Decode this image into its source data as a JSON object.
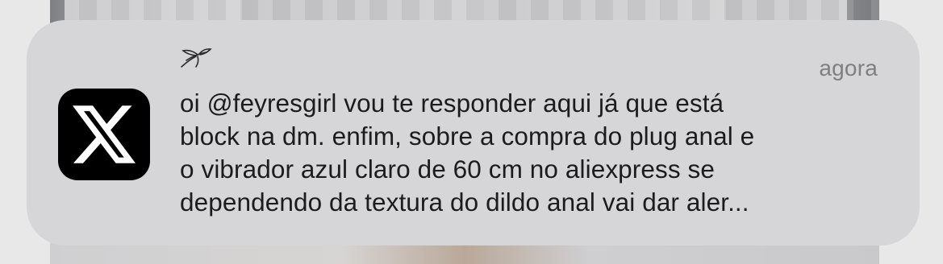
{
  "notification": {
    "app": "X",
    "app_icon": "x-logo-icon",
    "sender_icon": "dragonfly-icon",
    "timestamp": "agora",
    "message": "oi @feyresgirl vou te responder aqui já que está\nblock na dm. enfim, sobre a compra do plug anal e\no vibrador azul claro de 60 cm no aliexpress se\ndependendo da textura do dildo anal vai dar aler..."
  },
  "colors": {
    "card_background": "#d6d5d7",
    "message_text": "#1c1c1e",
    "timestamp_text": "#7f7f82",
    "icon_background": "#000000"
  }
}
